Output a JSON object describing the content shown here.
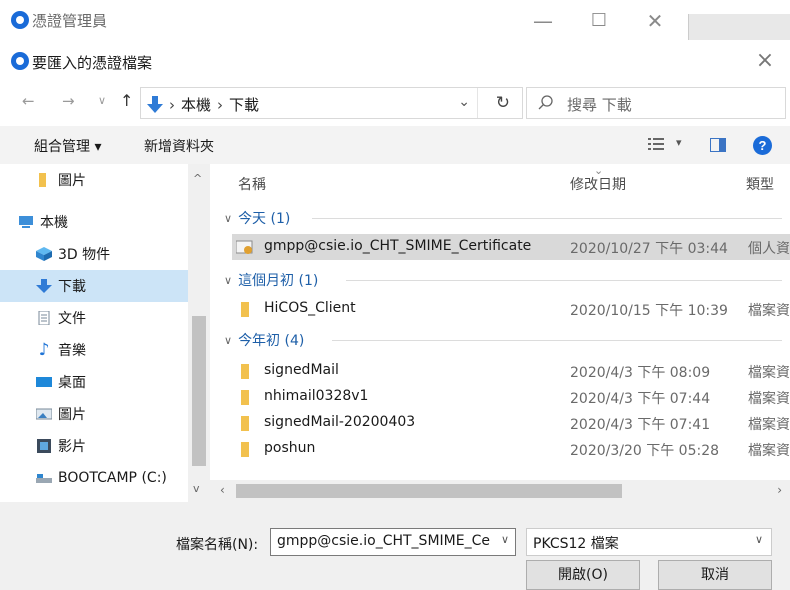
{
  "parent_window": {
    "title": "憑證管理員"
  },
  "dialog": {
    "title": "要匯入的憑證檔案"
  },
  "nav": {
    "breadcrumbs": [
      "本機",
      "下載"
    ],
    "search_placeholder": "搜尋 下載"
  },
  "toolbar": {
    "organize_label": "組合管理 ▾",
    "new_folder_label": "新增資料夾"
  },
  "sidebar": {
    "items": [
      {
        "label": "圖片",
        "icon": "folder-icon"
      },
      {
        "label": "本機",
        "icon": "computer-icon"
      },
      {
        "label": "3D 物件",
        "icon": "3d-objects-icon"
      },
      {
        "label": "下載",
        "icon": "download-icon",
        "selected": true
      },
      {
        "label": "文件",
        "icon": "document-icon"
      },
      {
        "label": "音樂",
        "icon": "music-icon"
      },
      {
        "label": "桌面",
        "icon": "desktop-icon"
      },
      {
        "label": "圖片",
        "icon": "pictures-icon"
      },
      {
        "label": "影片",
        "icon": "video-icon"
      },
      {
        "label": "BOOTCAMP (C:)",
        "icon": "drive-icon"
      }
    ]
  },
  "columns": {
    "name": "名稱",
    "date": "修改日期",
    "type": "類型"
  },
  "groups": [
    {
      "label": "今天 (1)",
      "files": [
        {
          "name": "gmpp@csie.io_CHT_SMIME_Certificate",
          "date": "2020/10/27 下午 03:44",
          "type": "個人資訊交換",
          "icon": "certificate-icon",
          "selected": true
        }
      ]
    },
    {
      "label": "這個月初 (1)",
      "files": [
        {
          "name": "HiCOS_Client",
          "date": "2020/10/15 下午 10:39",
          "type": "檔案資料夾",
          "icon": "folder-icon"
        }
      ]
    },
    {
      "label": "今年初 (4)",
      "files": [
        {
          "name": "signedMail",
          "date": "2020/4/3 下午 08:09",
          "type": "檔案資料夾",
          "icon": "folder-icon"
        },
        {
          "name": "nhimail0328v1",
          "date": "2020/4/3 下午 07:44",
          "type": "檔案資料夾",
          "icon": "folder-icon"
        },
        {
          "name": "signedMail-20200403",
          "date": "2020/4/3 下午 07:41",
          "type": "檔案資料夾",
          "icon": "folder-icon"
        },
        {
          "name": "poshun",
          "date": "2020/3/20 下午 05:28",
          "type": "檔案資料夾",
          "icon": "folder-icon"
        }
      ]
    }
  ],
  "footer": {
    "filename_label": "檔案名稱(N):",
    "filename_value": "gmpp@csie.io_CHT_SMIME_Certificate",
    "filetype_value": "PKCS12 檔案",
    "open_label": "開啟(O)",
    "cancel_label": "取消"
  },
  "colors": {
    "accent": "#1a6bd8",
    "selection": "#cce4f7",
    "folder": "#f2c14e"
  }
}
